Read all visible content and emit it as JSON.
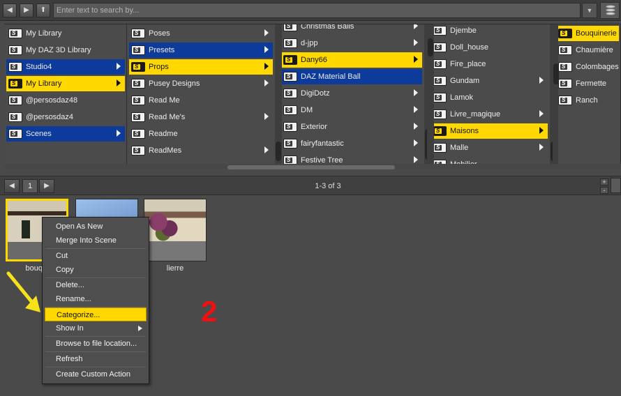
{
  "toolbar": {
    "search_placeholder": "Enter text to search by...",
    "icons": [
      "back-arrow-icon",
      "forward-arrow-icon",
      "up-arrow-icon",
      "dropdown-icon",
      "database-icon"
    ]
  },
  "columns": [
    {
      "items": [
        {
          "label": "My Library",
          "state": "normal",
          "arrow": false
        },
        {
          "label": "My DAZ 3D Library",
          "state": "normal",
          "arrow": false
        },
        {
          "label": "Studio4",
          "state": "blue",
          "arrow": true
        },
        {
          "label": "My Library",
          "state": "yellow",
          "arrow": true
        },
        {
          "label": "@persosdaz48",
          "state": "normal",
          "arrow": false
        },
        {
          "label": "@persosdaz4",
          "state": "normal",
          "arrow": false
        },
        {
          "label": "Scenes",
          "state": "blue",
          "arrow": true
        }
      ]
    },
    {
      "items": [
        {
          "label": "Poses",
          "state": "normal",
          "arrow": true
        },
        {
          "label": "Presets",
          "state": "blue",
          "arrow": true
        },
        {
          "label": "Props",
          "state": "yellow",
          "arrow": true
        },
        {
          "label": "Pusey Designs",
          "state": "normal",
          "arrow": true
        },
        {
          "label": "Read Me",
          "state": "normal",
          "arrow": false
        },
        {
          "label": "Read Me's",
          "state": "normal",
          "arrow": true
        },
        {
          "label": "Readme",
          "state": "normal",
          "arrow": false
        },
        {
          "label": "ReadMes",
          "state": "normal",
          "arrow": true
        }
      ]
    },
    {
      "items": [
        {
          "label": "Christmas Balls",
          "state": "normal",
          "arrow": true
        },
        {
          "label": "d-jpp",
          "state": "normal",
          "arrow": true
        },
        {
          "label": "Dany66",
          "state": "yellow",
          "arrow": true
        },
        {
          "label": "DAZ Material Ball",
          "state": "blue",
          "arrow": false
        },
        {
          "label": "DigiDotz",
          "state": "normal",
          "arrow": true
        },
        {
          "label": "DM",
          "state": "normal",
          "arrow": true
        },
        {
          "label": "Exterior",
          "state": "normal",
          "arrow": true
        },
        {
          "label": "fairyfantastic",
          "state": "normal",
          "arrow": true
        },
        {
          "label": "Festive Tree",
          "state": "normal",
          "arrow": true
        }
      ]
    },
    {
      "items": [
        {
          "label": "Djembe",
          "state": "normal",
          "arrow": false
        },
        {
          "label": "Doll_house",
          "state": "normal",
          "arrow": false
        },
        {
          "label": "Fire_place",
          "state": "normal",
          "arrow": false
        },
        {
          "label": "Gundam",
          "state": "normal",
          "arrow": true
        },
        {
          "label": "Lamok",
          "state": "normal",
          "arrow": false
        },
        {
          "label": "Livre_magique",
          "state": "normal",
          "arrow": true
        },
        {
          "label": "Maisons",
          "state": "yellow",
          "arrow": true
        },
        {
          "label": "Malle",
          "state": "normal",
          "arrow": true
        },
        {
          "label": "Mobilier",
          "state": "normal",
          "arrow": false
        }
      ]
    },
    {
      "items": [
        {
          "label": "Bouquinerie",
          "state": "yellow",
          "arrow": false
        },
        {
          "label": "Chaumière",
          "state": "normal",
          "arrow": false
        },
        {
          "label": "Colombages",
          "state": "normal",
          "arrow": false
        },
        {
          "label": "Fermette",
          "state": "normal",
          "arrow": false
        },
        {
          "label": "Ranch",
          "state": "normal",
          "arrow": false
        }
      ]
    }
  ],
  "pager": {
    "page": "1",
    "count_text": "1-3 of 3"
  },
  "thumbnails": [
    {
      "label": "bouqui",
      "selected": true
    },
    {
      "label": "",
      "selected": false
    },
    {
      "label": "lierre",
      "selected": false
    }
  ],
  "context_menu": {
    "items": [
      {
        "label": "Open As New",
        "highlight": false,
        "submenu": false
      },
      {
        "label": "Merge Into Scene",
        "highlight": false,
        "submenu": false
      },
      {
        "label": "Cut",
        "highlight": false,
        "submenu": false
      },
      {
        "label": "Copy",
        "highlight": false,
        "submenu": false
      },
      {
        "label": "Delete...",
        "highlight": false,
        "submenu": false
      },
      {
        "label": "Rename...",
        "highlight": false,
        "submenu": false
      },
      {
        "label": "Categorize...",
        "highlight": true,
        "submenu": false
      },
      {
        "label": "Show In",
        "highlight": false,
        "submenu": true
      },
      {
        "label": "Browse to file location...",
        "highlight": false,
        "submenu": false
      },
      {
        "label": "Refresh",
        "highlight": false,
        "submenu": false
      },
      {
        "label": "Create Custom Action",
        "highlight": false,
        "submenu": false
      }
    ]
  },
  "annotation": {
    "step_number": "2",
    "arrow_color": "#f5e21a",
    "number_color": "#f01010"
  },
  "colors": {
    "selected_blue": "#0c3b9c",
    "selected_yellow": "#ffd800",
    "background": "#4a4a4a"
  }
}
